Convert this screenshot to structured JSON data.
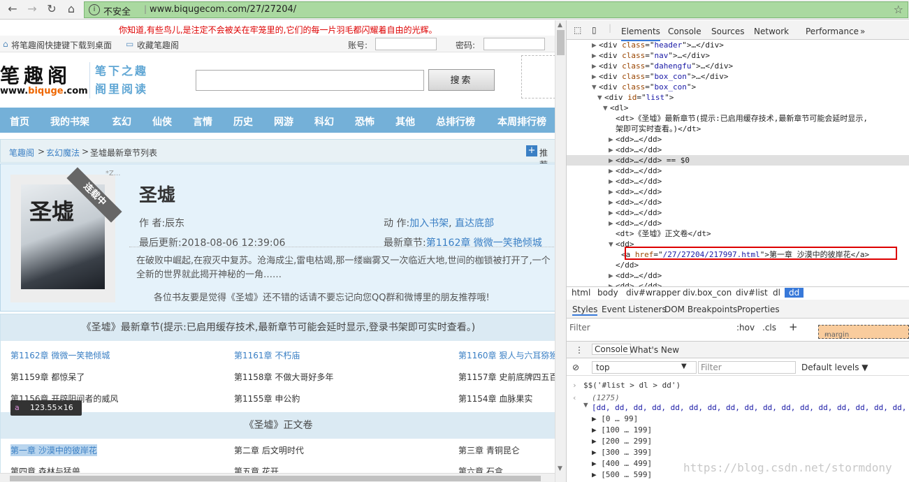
{
  "browser": {
    "security": "不安全",
    "url": "www.biqugecom.com/27/27204/"
  },
  "site": {
    "tip": "你知道,有些鸟儿,是注定不会被关在牢笼里的,它们的每一片羽毛都闪耀着自由的光辉。",
    "shortcut": "将笔趣阁快捷键下载到桌面",
    "bookmark": "收藏笔趣阁",
    "account_label": "账号:",
    "password_label": "密码:",
    "logo": "笔趣阁",
    "logo_domain_pre": "www.",
    "logo_domain_mid": "biquge",
    "logo_domain_post": ".com",
    "slogan1": "笔下之趣",
    "slogan2": "阁里阅读",
    "search_button": "搜索",
    "nav": [
      "首页",
      "我的书架",
      "玄幻",
      "仙侠",
      "言情",
      "历史",
      "网游",
      "科幻",
      "恐怖",
      "其他",
      "总排行榜",
      "本周排行榜"
    ],
    "crumb": [
      "笔趣阁",
      "玄幻魔法",
      "圣墟最新章节列表"
    ],
    "crumb_sep": ">",
    "recommend": "推荐"
  },
  "book": {
    "title": "圣墟",
    "cover_title": "圣墟",
    "status": "连载中",
    "mini": "*Z...",
    "author_label": "作    者:",
    "author": "辰东",
    "action_label": "动    作:",
    "action1": "加入书架",
    "action2": "直达底部",
    "updated_label": "最后更新:",
    "updated": "2018-08-06 12:39:06",
    "latest_label": "最新章节:",
    "latest": "第1162章 微微一笑艳倾城",
    "desc": "在破败中崛起,在寂灭中复苏。沧海成尘,雷电枯竭,那一缕幽雾又一次临近大地,世间的枷锁被打开了,一个全新的世界就此揭开神秘的一角……",
    "share": "各位书友要是觉得《圣墟》还不错的话请不要忘记向您QQ群和微博里的朋友推荐哦!"
  },
  "chapters": {
    "latest_head": "《圣墟》最新章节(提示:已启用缓存技术,最新章节可能会延时显示,登录书架即可实时查看。)",
    "latest": [
      [
        "第1162章 微微一笑艳倾城",
        "第1161章 不朽庙",
        "第1160章 狠人与六耳猕猴"
      ],
      [
        "第1159章 都惊呆了",
        "第1158章 不做大哥好多年",
        "第1157章 史前底牌四五百"
      ],
      [
        "第1156章 开辟阳间者的威风",
        "第1155章 申公豹",
        "第1154章 血脉果实"
      ]
    ],
    "main_head": "《圣墟》正文卷",
    "main": [
      [
        "第一章 沙漠中的彼岸花",
        "第二章 后文明时代",
        "第三章 青铜昆仑"
      ],
      [
        "第四章 森林与猛兽",
        "第五章 花开",
        "第六章 石盒"
      ]
    ]
  },
  "tooltip": {
    "tag": "a",
    "size": "123.55×16"
  },
  "devtools": {
    "tabs": [
      "Elements",
      "Console",
      "Sources",
      "Network",
      "Performance"
    ],
    "tree": [
      {
        "ind": 4,
        "tri": "▶",
        "html": [
          [
            "<div ",
            "t"
          ],
          [
            "class",
            "a"
          ],
          [
            "=\"",
            "t"
          ],
          [
            "header",
            "v"
          ],
          [
            "\">…</div>",
            "t"
          ]
        ]
      },
      {
        "ind": 4,
        "tri": "▶",
        "html": [
          [
            "<div ",
            "t"
          ],
          [
            "class",
            "a"
          ],
          [
            "=\"",
            "t"
          ],
          [
            "nav",
            "v"
          ],
          [
            "\">…</div>",
            "t"
          ]
        ]
      },
      {
        "ind": 4,
        "tri": "▶",
        "html": [
          [
            "<div ",
            "t"
          ],
          [
            "class",
            "a"
          ],
          [
            "=\"",
            "t"
          ],
          [
            "dahengfu",
            "v"
          ],
          [
            "\">…</div>",
            "t"
          ]
        ]
      },
      {
        "ind": 4,
        "tri": "▶",
        "html": [
          [
            "<div ",
            "t"
          ],
          [
            "class",
            "a"
          ],
          [
            "=\"",
            "t"
          ],
          [
            "box_con",
            "v"
          ],
          [
            "\">…</div>",
            "t"
          ]
        ]
      },
      {
        "ind": 4,
        "tri": "▼",
        "html": [
          [
            "<div ",
            "t"
          ],
          [
            "class",
            "a"
          ],
          [
            "=\"",
            "t"
          ],
          [
            "box_con",
            "v"
          ],
          [
            "\">",
            "t"
          ]
        ]
      },
      {
        "ind": 6,
        "tri": "▼",
        "html": [
          [
            "<div ",
            "t"
          ],
          [
            "id",
            "a"
          ],
          [
            "=\"",
            "t"
          ],
          [
            "list",
            "v"
          ],
          [
            "\">",
            "t"
          ]
        ]
      },
      {
        "ind": 8,
        "tri": "▼",
        "html": [
          [
            "<dl>",
            "t"
          ]
        ]
      },
      {
        "ind": 10,
        "tri": "",
        "html": [
          [
            "<dt>",
            "t"
          ],
          [
            "《圣墟》最新章节(提示:已启用缓存技术,最新章节可能会延时显示,",
            "t"
          ]
        ]
      },
      {
        "ind": 10,
        "tri": "",
        "html": [
          [
            "架即可实时查看。)</dt>",
            "t"
          ]
        ]
      },
      {
        "ind": 10,
        "tri": "▶",
        "html": [
          [
            "<dd>…</dd>",
            "t"
          ]
        ]
      },
      {
        "ind": 10,
        "tri": "▶",
        "html": [
          [
            "<dd>…</dd>",
            "t"
          ]
        ]
      },
      {
        "ind": 10,
        "tri": "▶",
        "html": [
          [
            "<dd>…</dd>",
            "t"
          ],
          [
            " == $0",
            "t"
          ]
        ]
      },
      {
        "ind": 10,
        "tri": "▶",
        "html": [
          [
            "<dd>…</dd>",
            "t"
          ]
        ]
      },
      {
        "ind": 10,
        "tri": "▶",
        "html": [
          [
            "<dd>…</dd>",
            "t"
          ]
        ]
      },
      {
        "ind": 10,
        "tri": "▶",
        "html": [
          [
            "<dd>…</dd>",
            "t"
          ]
        ]
      },
      {
        "ind": 10,
        "tri": "▶",
        "html": [
          [
            "<dd>…</dd>",
            "t"
          ]
        ]
      },
      {
        "ind": 10,
        "tri": "▶",
        "html": [
          [
            "<dd>…</dd>",
            "t"
          ]
        ]
      },
      {
        "ind": 10,
        "tri": "▶",
        "html": [
          [
            "<dd>…</dd>",
            "t"
          ]
        ]
      },
      {
        "ind": 10,
        "tri": "",
        "html": [
          [
            "<dt>",
            "t"
          ],
          [
            "《圣墟》正文卷",
            "t"
          ],
          [
            "</dt>",
            "t"
          ]
        ]
      },
      {
        "ind": 10,
        "tri": "▼",
        "html": [
          [
            "<dd>",
            "t"
          ]
        ]
      },
      {
        "ind": 12,
        "tri": "",
        "html": [
          [
            "<a ",
            "t"
          ],
          [
            "href",
            "a"
          ],
          [
            "=\"",
            "t"
          ],
          [
            "/27/27204/217997.html",
            "v"
          ],
          [
            "\">",
            "t"
          ],
          [
            "第一章 沙漠中的彼岸花",
            "t"
          ],
          [
            "</a>",
            "t"
          ]
        ]
      },
      {
        "ind": 10,
        "tri": "",
        "html": [
          [
            "</dd>",
            "t"
          ]
        ]
      },
      {
        "ind": 10,
        "tri": "▶",
        "html": [
          [
            "<dd>…</dd>",
            "t"
          ]
        ]
      },
      {
        "ind": 10,
        "tri": "▶",
        "html": [
          [
            "<dd>…</dd>",
            "t"
          ]
        ]
      }
    ],
    "breadcrumb": [
      "html",
      "body",
      "div#wrapper",
      "div.box_con",
      "div#list",
      "dl",
      "dd"
    ],
    "style_tabs": [
      "Styles",
      "Event Listeners",
      "DOM Breakpoints",
      "Properties"
    ],
    "filter": "Filter",
    "hov": ":hov",
    "cls": ".cls",
    "box_label": "margin",
    "box_val": "–",
    "console_tabs": [
      "Console",
      "What's New"
    ],
    "context": "top",
    "console_filter": "Filter",
    "levels": "Default levels ▼",
    "command": "$$('#list > dl > dd')",
    "count": "(1275)",
    "array": "[dd, dd, dd, dd, dd, dd, dd, dd, dd, dd, dd, dd, dd, dd, dd, dd, dd, dd,",
    "groups": [
      "[0 … 99]",
      "[100 … 199]",
      "[200 … 299]",
      "[300 … 399]",
      "[400 … 499]",
      "[500 … 599]"
    ]
  },
  "watermark": "https://blog.csdn.net/stormdony"
}
